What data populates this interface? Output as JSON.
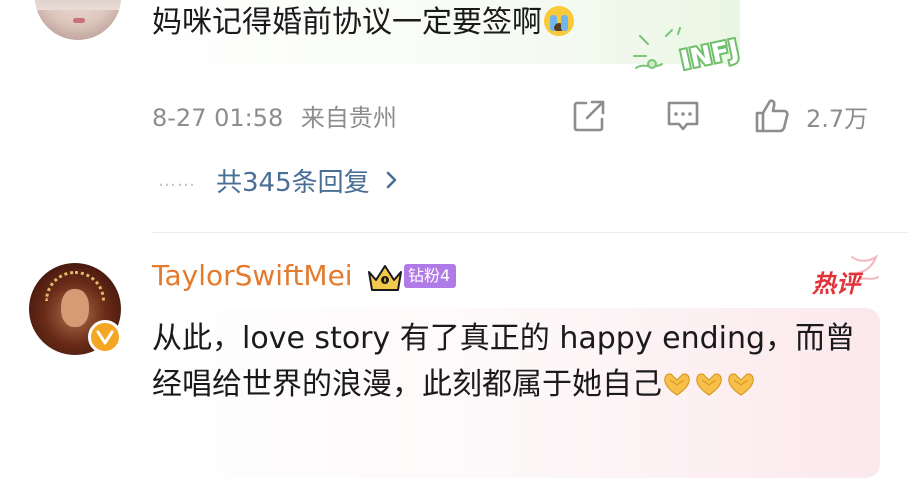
{
  "comment1": {
    "text": "妈咪记得婚前协议一定要签啊",
    "emoji": "crying-face-icon",
    "badge_text": "INFJ",
    "time": "8-27 01:58",
    "location": "来自贵州",
    "likes": "2.7万"
  },
  "replies": {
    "dots": "……",
    "label": "共345条回复"
  },
  "comment2": {
    "username": "TaylorSwiftMei",
    "fan_badge": "钻粉4",
    "hot_label": "热评",
    "text": "从此，love story 有了真正的 happy ending，而曾经唱给世界的浪漫，此刻都属于她自己",
    "emoji": "heart-hands-icon"
  },
  "colors": {
    "username": "#e47a2e",
    "link": "#4a6f97",
    "meta": "#8d8d8d",
    "hot": "#e2323a",
    "fan_badge": "#b07be6",
    "verified": "#f5a623"
  }
}
